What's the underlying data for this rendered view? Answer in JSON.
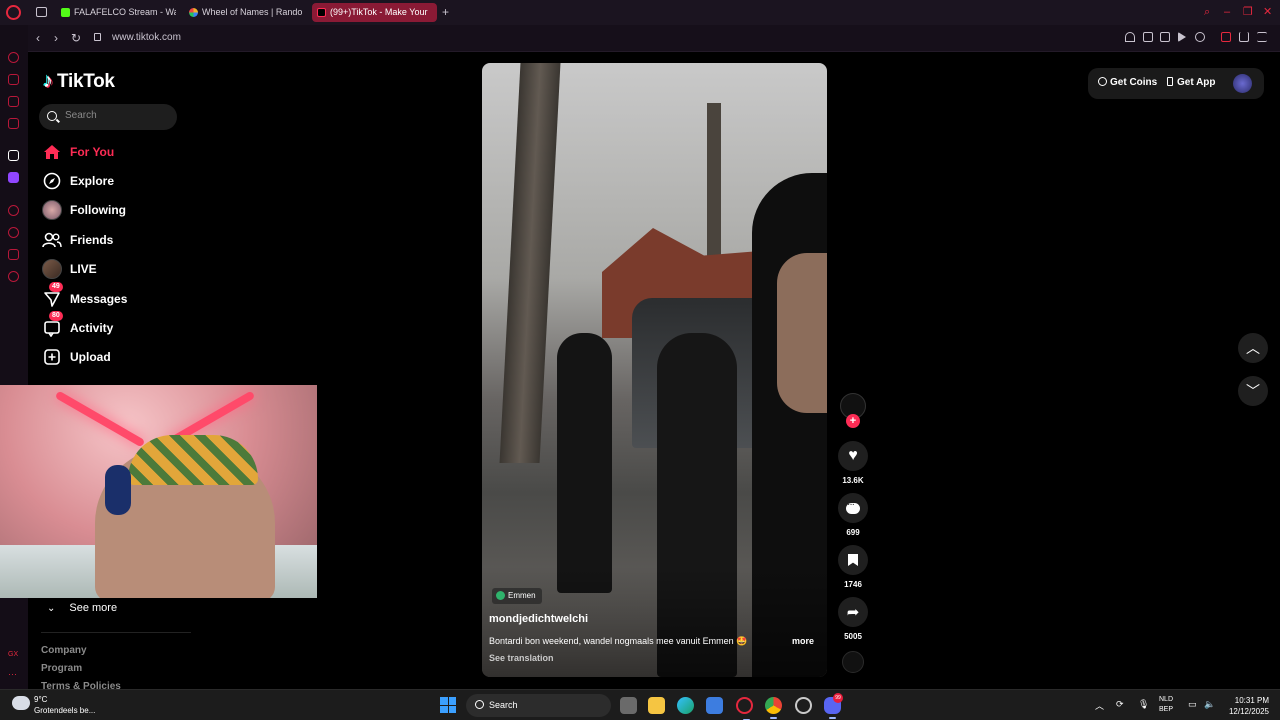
{
  "browser": {
    "tabs": [
      {
        "title": "FALAFELCO Stream - Wat",
        "favicon_color": "#53fc18"
      },
      {
        "title": "Wheel of Names | Rando",
        "favicon_color": "#f0b429"
      },
      {
        "title": "(99+)TikTok - Make Your",
        "favicon_color": "#000000",
        "active": true
      }
    ],
    "new_tab": "+",
    "url": "www.tiktok.com",
    "accent_color": "#e5283e"
  },
  "tiktok": {
    "brand": "TikTok",
    "search_placeholder": "Search",
    "nav": [
      {
        "label": "For You",
        "icon": "home-icon",
        "active": true
      },
      {
        "label": "Explore",
        "icon": "compass-icon"
      },
      {
        "label": "Following",
        "icon": "avatar"
      },
      {
        "label": "Friends",
        "icon": "friends-icon"
      },
      {
        "label": "LIVE",
        "icon": "avatar"
      },
      {
        "label": "Messages",
        "icon": "messages-icon",
        "badge": "49"
      },
      {
        "label": "Activity",
        "icon": "activity-icon",
        "badge": "80"
      },
      {
        "label": "Upload",
        "icon": "upload-icon"
      }
    ],
    "see_more": "See more",
    "footer_links": [
      "Company",
      "Program",
      "Terms & Policies"
    ],
    "top_actions": {
      "get_coins": "Get Coins",
      "get_app": "Get App"
    },
    "brand_color": "#fe2c55"
  },
  "video": {
    "location": "Emmen",
    "author": "mondjedichtwelchi",
    "caption": "Bontardi bon weekend, wandel nogmaals mee vanuit Emmen 🤩",
    "more": "more",
    "see_translation": "See translation",
    "stats": {
      "likes": "13.6K",
      "comments": "699",
      "saves": "1746",
      "shares": "5005"
    }
  },
  "taskbar": {
    "weather_temp": "9°C",
    "weather_desc": "Grotendeels be...",
    "search_label": "Search",
    "lang_line1": "NLD",
    "lang_line2": "BEP",
    "time": "10:31 PM",
    "date": "12/12/2025",
    "discord_badge": "99"
  }
}
